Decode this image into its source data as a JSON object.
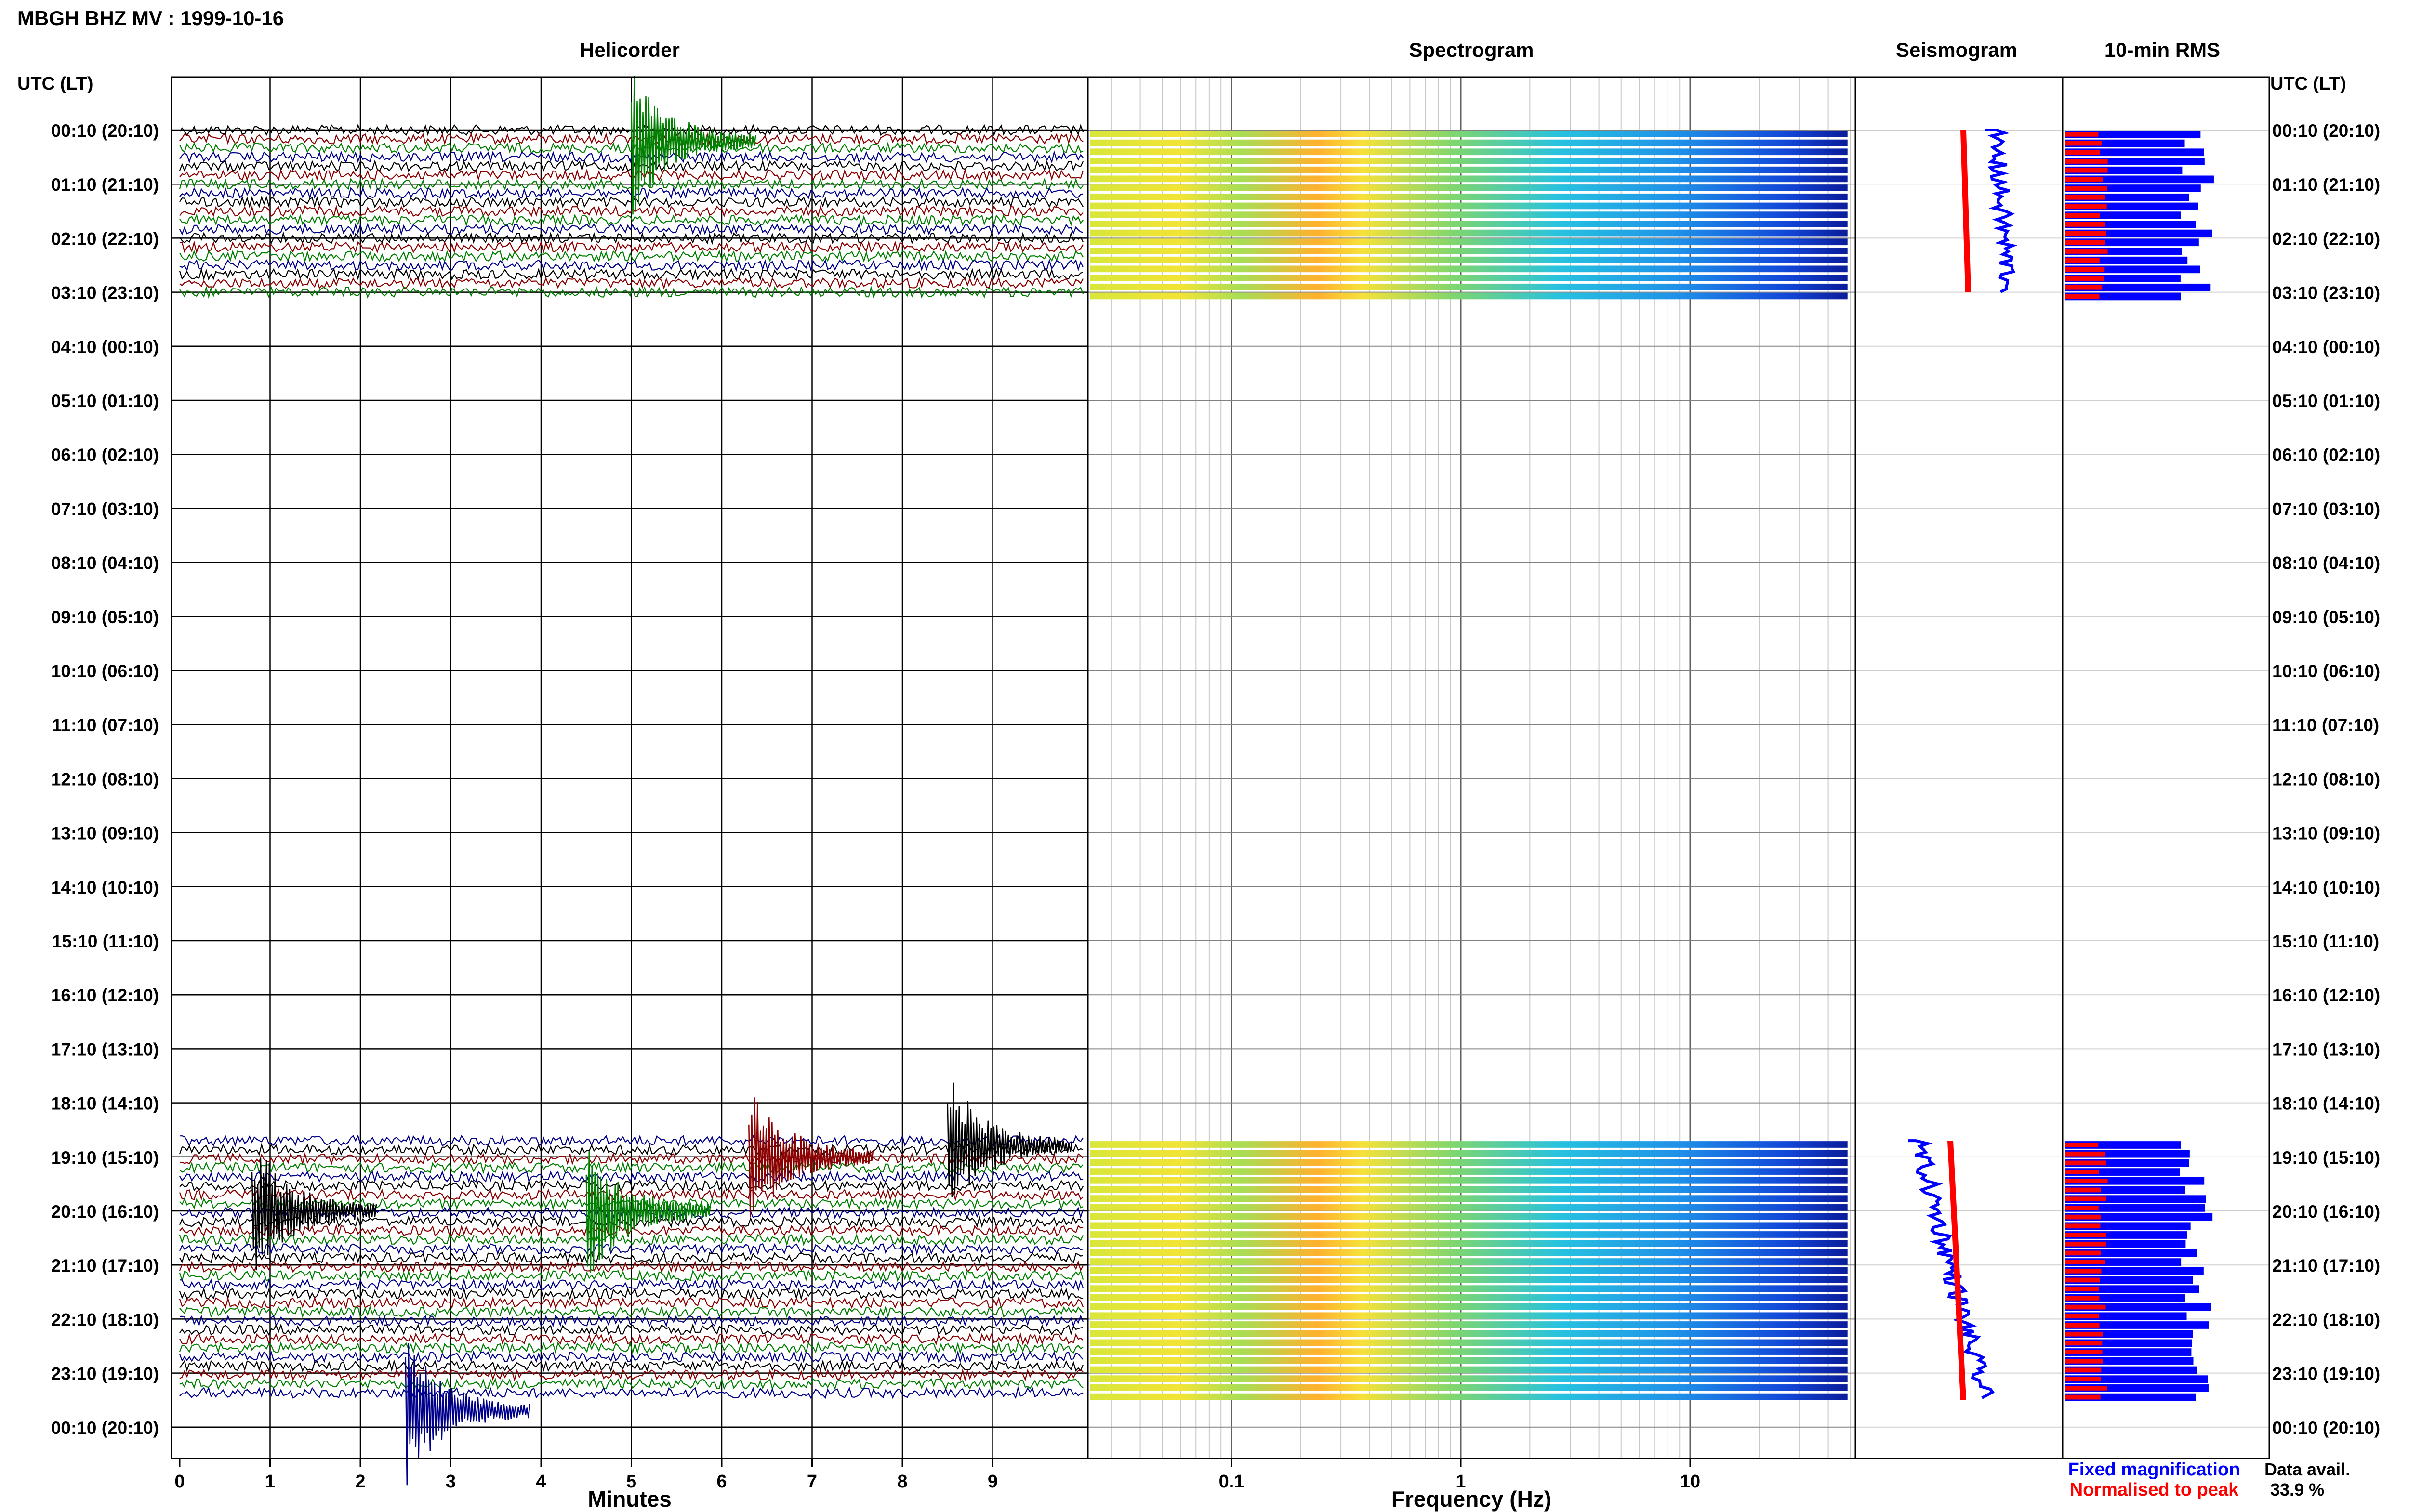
{
  "header": {
    "title": "MBGH BHZ MV : 1999-10-16",
    "utc_label": "UTC (LT)"
  },
  "panels": {
    "helicorder": "Helicorder",
    "spectrogram": "Spectrogram",
    "seismogram": "Seismogram",
    "rms": "10-min RMS"
  },
  "footer": {
    "fixed_label": "Fixed magnification",
    "normalised_label": "Normalised to peak",
    "avail_label": "Data avail.",
    "avail_value": "33.9 %"
  },
  "colors": {
    "trace_cycle": [
      "#000000",
      "#8b0000",
      "#008000",
      "#00008b"
    ],
    "fixed": "#0000ff",
    "normalised": "#ff0000",
    "grid": "#9a9a9a",
    "frame": "#000000"
  },
  "chart_data": [
    {
      "type": "line",
      "name": "helicorder",
      "title": "Helicorder",
      "xlabel": "Minutes",
      "x_ticks": [
        "0",
        "1",
        "2",
        "3",
        "4",
        "5",
        "6",
        "7",
        "8",
        "9"
      ],
      "xlim": [
        0,
        10
      ],
      "hour_labels": [
        "00:10 (20:10)",
        "01:10 (21:10)",
        "02:10 (22:10)",
        "03:10 (23:10)",
        "04:10 (00:10)",
        "05:10 (01:10)",
        "06:10 (02:10)",
        "07:10 (03:10)",
        "08:10 (04:10)",
        "09:10 (05:10)",
        "10:10 (06:10)",
        "11:10 (07:10)",
        "12:10 (08:10)",
        "13:10 (09:10)",
        "14:10 (10:10)",
        "15:10 (11:10)",
        "16:10 (12:10)",
        "17:10 (13:10)",
        "18:10 (14:10)",
        "19:10 (15:10)",
        "20:10 (16:10)",
        "21:10 (17:10)",
        "22:10 (18:10)",
        "23:10 (19:10)",
        "00:10 (20:10)"
      ],
      "data_hours": [
        [
          0.0,
          3.0
        ],
        [
          18.7,
          23.5
        ]
      ],
      "events": [
        {
          "hour": 0.2,
          "minute": 5.0,
          "color": "green"
        },
        {
          "hour": 19.0,
          "minute": 6.3,
          "color": "darkred"
        },
        {
          "hour": 18.8,
          "minute": 8.5,
          "color": "black"
        },
        {
          "hour": 20.0,
          "minute": 0.8,
          "color": "black"
        },
        {
          "hour": 20.0,
          "minute": 4.5,
          "color": "green"
        },
        {
          "hour": 23.7,
          "minute": 2.5,
          "color": "darkblue"
        }
      ]
    },
    {
      "type": "heatmap",
      "name": "spectrogram",
      "title": "Spectrogram",
      "xlabel": "Frequency (Hz)",
      "x_scale": "log",
      "xlim": [
        0.02,
        50
      ],
      "x_ticks": [
        "0.1",
        "1",
        "10"
      ],
      "data_hours": [
        [
          0.0,
          3.0
        ],
        [
          18.7,
          23.5
        ]
      ]
    },
    {
      "type": "line",
      "name": "seismogram",
      "title": "Seismogram",
      "series": [
        {
          "name": "Fixed magnification",
          "color": "#0000ff"
        },
        {
          "name": "Normalised to peak",
          "color": "#ff0000"
        }
      ]
    },
    {
      "type": "bar",
      "name": "rms",
      "title": "10-min RMS",
      "series": [
        {
          "name": "Fixed magnification",
          "color": "#0000ff"
        },
        {
          "name": "Normalised to peak",
          "color": "#ff0000"
        }
      ]
    }
  ]
}
